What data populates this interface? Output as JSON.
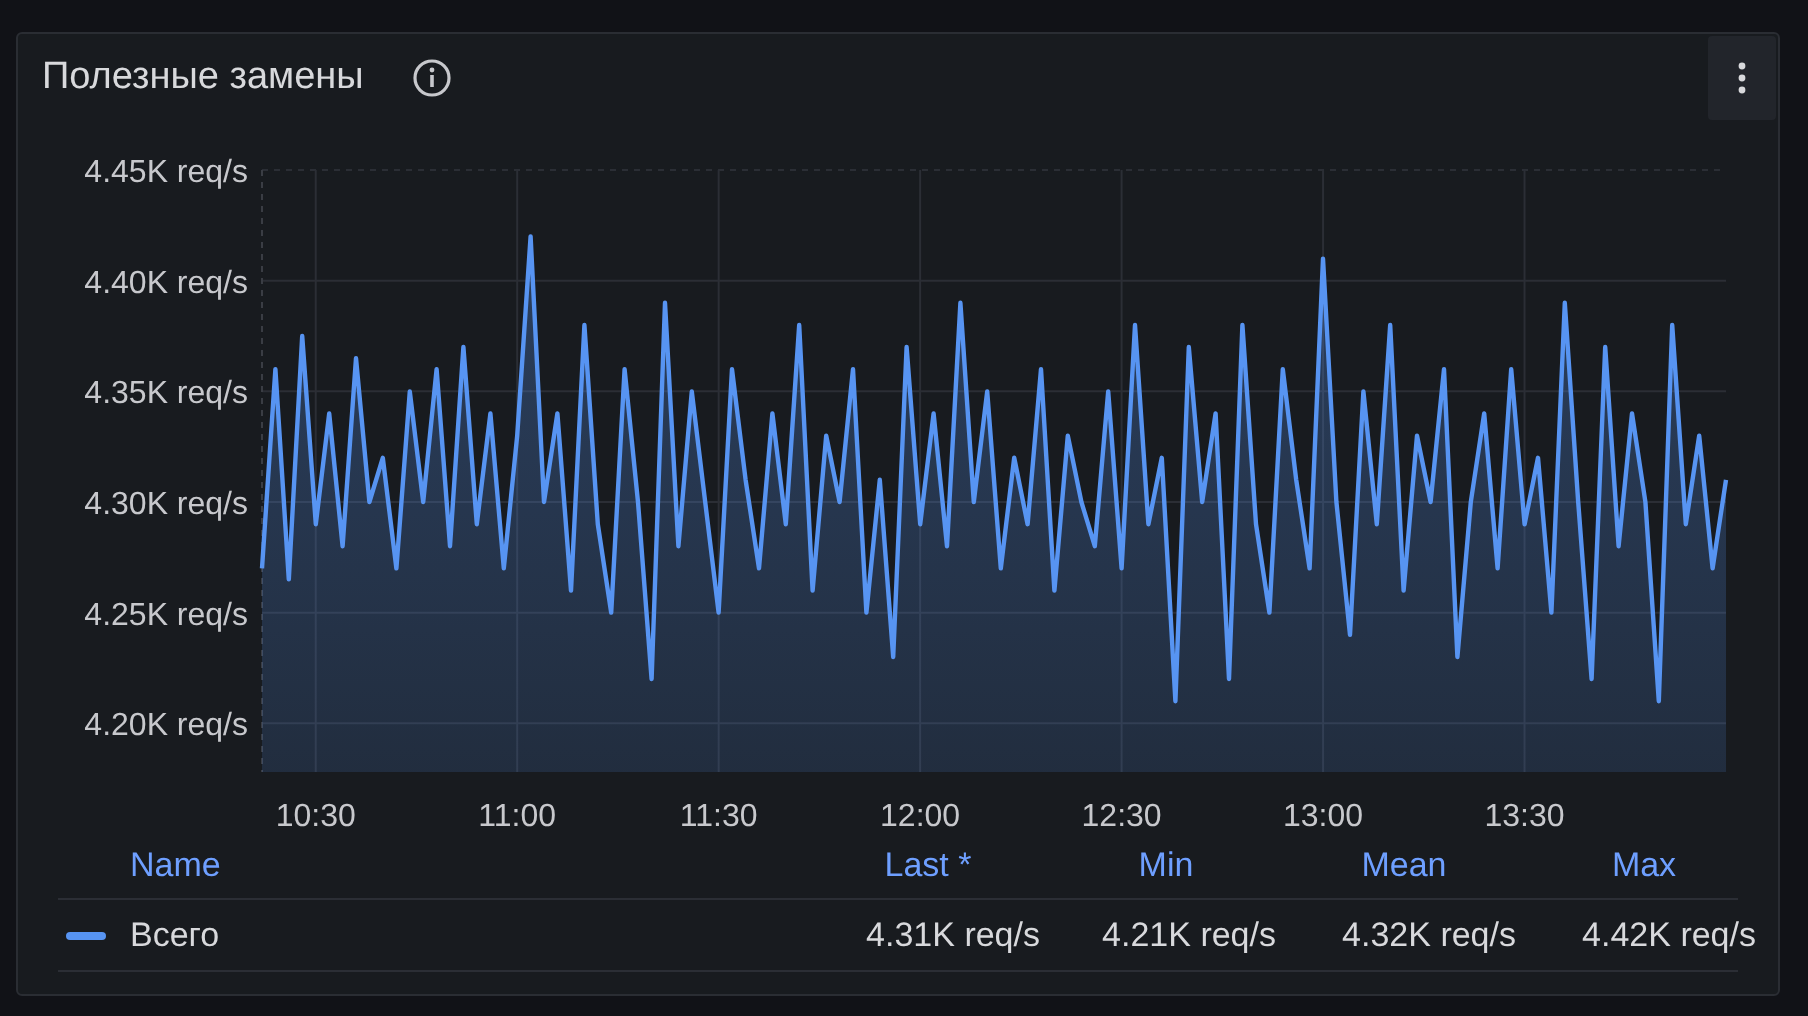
{
  "panel": {
    "title": "Полезные замены",
    "chart_data": {
      "type": "area",
      "grid": true,
      "ylim": [
        4178,
        4450
      ],
      "xlim": [
        622,
        840
      ],
      "yticks": [
        {
          "value": 4200,
          "label": "4.20K req/s"
        },
        {
          "value": 4250,
          "label": "4.25K req/s"
        },
        {
          "value": 4300,
          "label": "4.30K req/s"
        },
        {
          "value": 4350,
          "label": "4.35K req/s"
        },
        {
          "value": 4400,
          "label": "4.40K req/s"
        },
        {
          "value": 4450,
          "label": "4.45K req/s"
        }
      ],
      "xticks": [
        {
          "value": 630,
          "label": "10:30"
        },
        {
          "value": 660,
          "label": "11:00"
        },
        {
          "value": 690,
          "label": "11:30"
        },
        {
          "value": 720,
          "label": "12:00"
        },
        {
          "value": 750,
          "label": "12:30"
        },
        {
          "value": 780,
          "label": "13:00"
        },
        {
          "value": 810,
          "label": "13:30"
        }
      ],
      "x": [
        622,
        624,
        626,
        628,
        630,
        632,
        634,
        636,
        638,
        640,
        642,
        644,
        646,
        648,
        650,
        652,
        654,
        656,
        658,
        660,
        662,
        664,
        666,
        668,
        670,
        672,
        674,
        676,
        678,
        680,
        682,
        684,
        686,
        688,
        690,
        692,
        694,
        696,
        698,
        700,
        702,
        704,
        706,
        708,
        710,
        712,
        714,
        716,
        718,
        720,
        722,
        724,
        726,
        728,
        730,
        732,
        734,
        736,
        738,
        740,
        742,
        744,
        746,
        748,
        750,
        752,
        754,
        756,
        758,
        760,
        762,
        764,
        766,
        768,
        770,
        772,
        774,
        776,
        778,
        780,
        782,
        784,
        786,
        788,
        790,
        792,
        794,
        796,
        798,
        800,
        802,
        804,
        806,
        808,
        810,
        812,
        814,
        816,
        818,
        820,
        822,
        824,
        826,
        828,
        830,
        832,
        834,
        836,
        838,
        840
      ],
      "series": [
        {
          "name": "Всего",
          "color": "#5794f2",
          "values": [
            4270,
            4360,
            4265,
            4375,
            4290,
            4340,
            4280,
            4365,
            4300,
            4320,
            4270,
            4350,
            4300,
            4360,
            4280,
            4370,
            4290,
            4340,
            4270,
            4330,
            4420,
            4300,
            4340,
            4260,
            4380,
            4290,
            4250,
            4360,
            4300,
            4220,
            4390,
            4280,
            4350,
            4300,
            4250,
            4360,
            4310,
            4270,
            4340,
            4290,
            4380,
            4260,
            4330,
            4300,
            4360,
            4250,
            4310,
            4230,
            4370,
            4290,
            4340,
            4280,
            4390,
            4300,
            4350,
            4270,
            4320,
            4290,
            4360,
            4260,
            4330,
            4300,
            4280,
            4350,
            4270,
            4380,
            4290,
            4320,
            4210,
            4370,
            4300,
            4340,
            4220,
            4380,
            4290,
            4250,
            4360,
            4310,
            4270,
            4410,
            4300,
            4240,
            4350,
            4290,
            4380,
            4260,
            4330,
            4300,
            4360,
            4230,
            4300,
            4340,
            4270,
            4360,
            4290,
            4320,
            4250,
            4390,
            4300,
            4220,
            4370,
            4280,
            4340,
            4300,
            4210,
            4380,
            4290,
            4330,
            4270,
            4310
          ]
        }
      ]
    },
    "legend": {
      "columns": [
        "Name",
        "Last *",
        "Min",
        "Mean",
        "Max"
      ],
      "rows": [
        {
          "values": [
            "4.31K req/s",
            "4.21K req/s",
            "4.32K req/s",
            "4.42K req/s"
          ]
        }
      ]
    }
  }
}
